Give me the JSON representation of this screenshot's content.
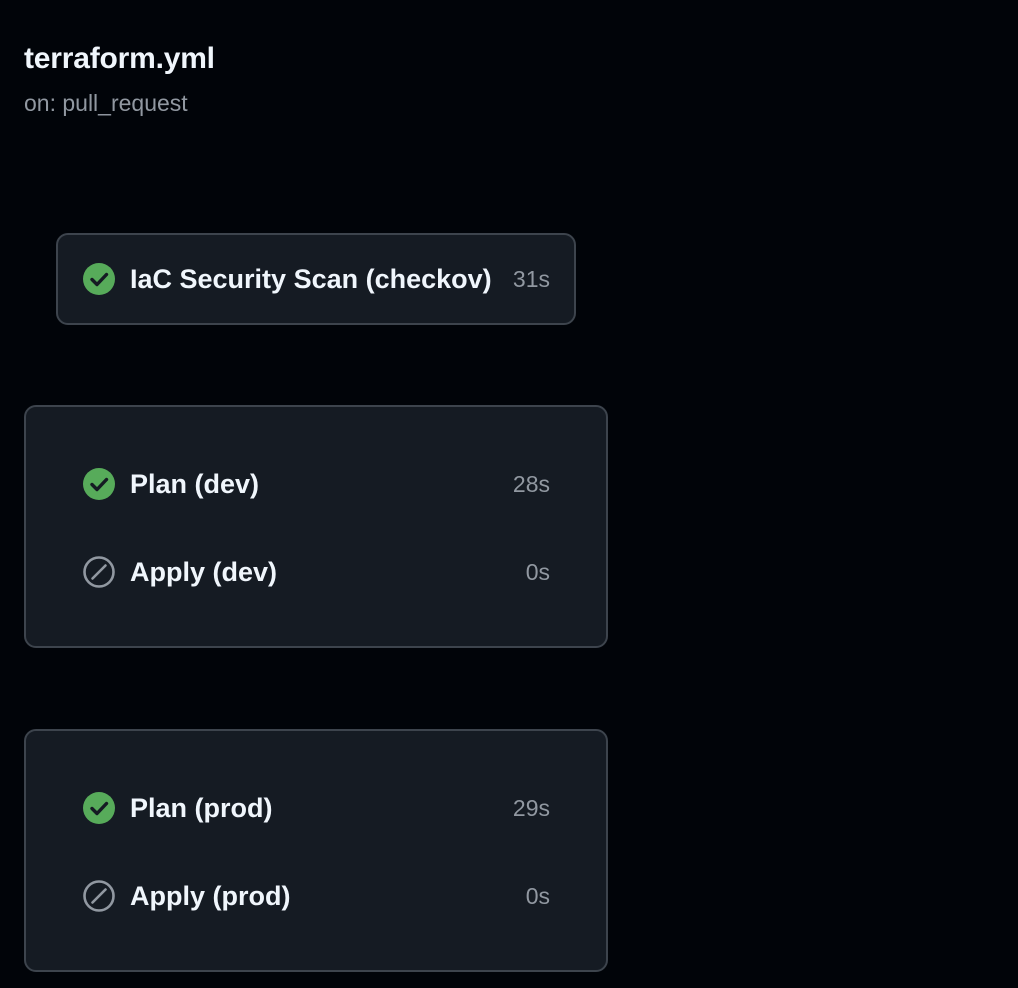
{
  "workflow": {
    "title": "terraform.yml",
    "trigger": "on: pull_request"
  },
  "colors": {
    "background": "#010409",
    "card_background": "#151b23",
    "card_border": "#3d444d",
    "success": "#57ab5a",
    "skipped": "#9198a1",
    "muted_text": "#9198a1"
  },
  "jobs": {
    "scan": {
      "name": "IaC Security Scan (checkov)",
      "duration": "31s",
      "status": "success",
      "icon": "check-circle-icon"
    },
    "dev": {
      "plan": {
        "name": "Plan (dev)",
        "duration": "28s",
        "status": "success",
        "icon": "check-circle-icon"
      },
      "apply": {
        "name": "Apply (dev)",
        "duration": "0s",
        "status": "skipped",
        "icon": "skip-icon"
      }
    },
    "prod": {
      "plan": {
        "name": "Plan (prod)",
        "duration": "29s",
        "status": "success",
        "icon": "check-circle-icon"
      },
      "apply": {
        "name": "Apply (prod)",
        "duration": "0s",
        "status": "skipped",
        "icon": "skip-icon"
      }
    }
  }
}
